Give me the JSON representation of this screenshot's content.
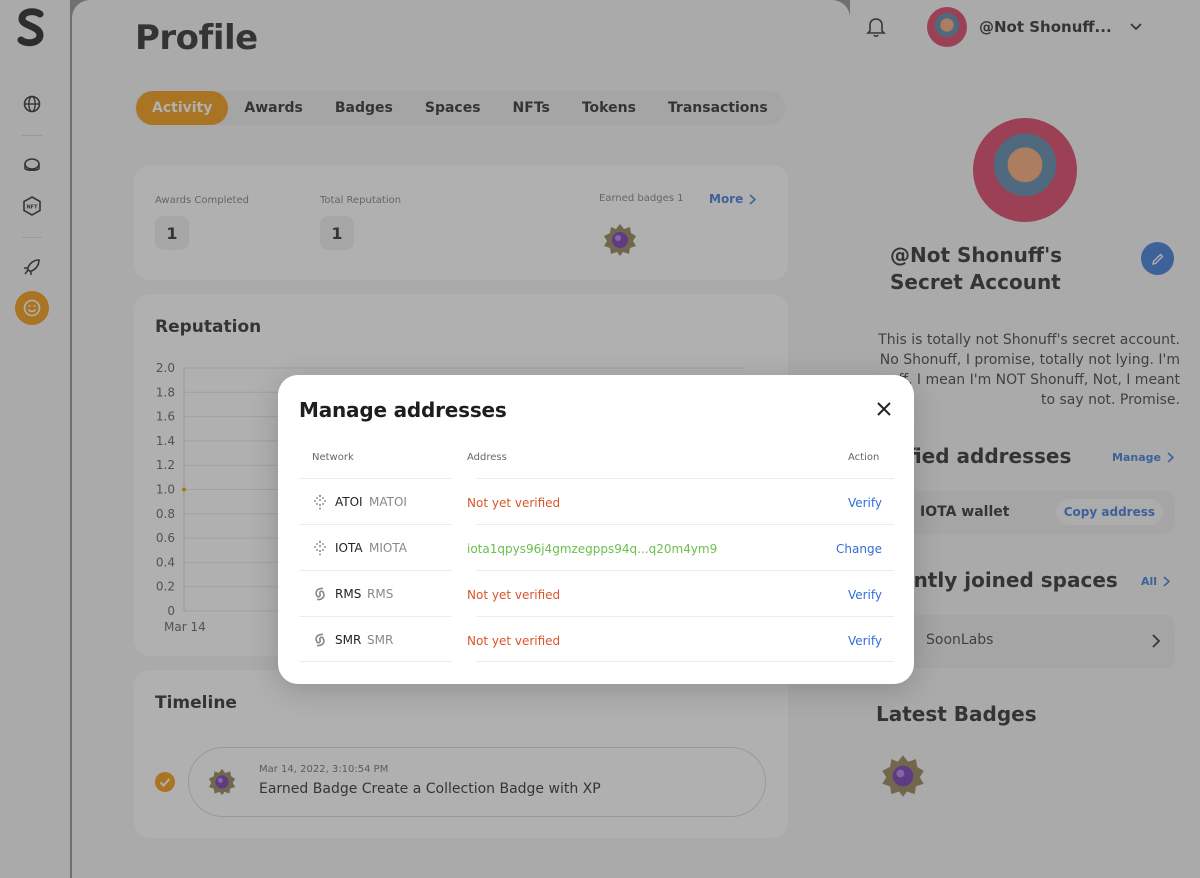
{
  "app": {
    "page_title": "Profile",
    "username": "@Not Shonuff..."
  },
  "tabs": [
    "Activity",
    "Awards",
    "Badges",
    "Spaces",
    "NFTs",
    "Tokens",
    "Transactions"
  ],
  "stats": {
    "awards_completed_label": "Awards Completed",
    "awards_completed_value": "1",
    "total_reputation_label": "Total Reputation",
    "total_reputation_value": "1",
    "earned_badges_label": "Earned badges 1",
    "more_label": "More"
  },
  "reputation": {
    "title": "Reputation",
    "chart_data": {
      "type": "line",
      "title": "Reputation",
      "x": [
        "Mar 14"
      ],
      "series": [
        {
          "values": [
            1.0
          ]
        }
      ],
      "ylim": [
        0,
        2.0
      ],
      "yticks": [
        "2.0",
        "1.8",
        "1.6",
        "1.4",
        "1.2",
        "1.0",
        "0.8",
        "0.6",
        "0.4",
        "0.2",
        "0"
      ],
      "xticks": [
        "Mar 14"
      ],
      "grid": true,
      "point_color": "#f39200"
    }
  },
  "timeline": {
    "title": "Timeline",
    "item_date": "Mar 14, 2022, 3:10:54 PM",
    "item_text": "Earned Badge Create a Collection Badge with XP"
  },
  "profile": {
    "name_line1": "@Not Shonuff's",
    "name_line2": "Secret Account",
    "bio_lines": [
      "This is totally not Shonuff's secret account.",
      "No Shonuff, I promise, totally not lying. I'm",
      "nuff, I mean I'm NOT Shonuff, Not, I meant",
      "to say not. Promise."
    ],
    "verified_title": "ified addresses",
    "manage_label": "Manage",
    "wallet_name": "IOTA wallet",
    "copy_label": "Copy address",
    "spaces_title": "ently joined spaces",
    "all_label": "All",
    "space_name": "SoonLabs",
    "badges_title": "Latest Badges"
  },
  "modal": {
    "title": "Manage addresses",
    "headers": {
      "network": "Network",
      "address": "Address",
      "action": "Action"
    },
    "rows": [
      {
        "network": "ATOI",
        "unit": "MATOI",
        "address": "Not yet verified",
        "action": "Verify"
      },
      {
        "network": "IOTA",
        "unit": "MIOTA",
        "address": "iota1qpys96j4gmzegpps94q...q20m4ym9",
        "action": "Change"
      },
      {
        "network": "RMS",
        "unit": "RMS",
        "address": "Not yet verified",
        "action": "Verify"
      },
      {
        "network": "SMR",
        "unit": "SMR",
        "address": "Not yet verified",
        "action": "Verify"
      }
    ]
  },
  "colors": {
    "accent": "#f39200",
    "link": "#2f6fd6",
    "unverified": "#d9552b",
    "verified": "#6bc04d"
  }
}
